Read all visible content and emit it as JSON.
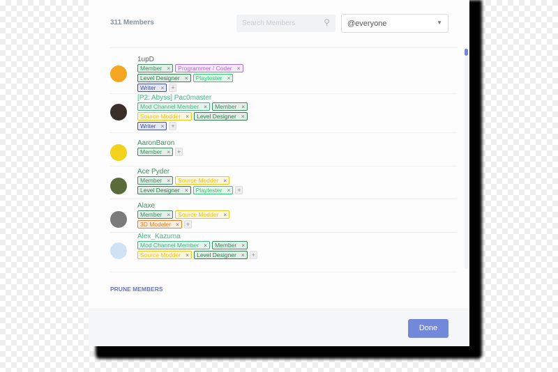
{
  "header": {
    "member_count": "311 Members",
    "search_placeholder": "Search Members",
    "role_filter": "@everyone"
  },
  "role_colors": {
    "Member": "#3d8c5e",
    "Mod Channel Member": "#43b581",
    "Level Designer": "#2f7d4c",
    "Playtester": "#2ecc71",
    "Programmer / Coder": "#b36ad8",
    "Source Modder": "#f1c40f",
    "Writer": "#3f4f99",
    "3D Modeler": "#e67e22"
  },
  "members": [
    {
      "name": "1upD",
      "name_color": "#5a6a5e",
      "avatar": "discord-logo",
      "avatar_color": "#f5a623",
      "roles": [
        "Member",
        "Programmer / Coder",
        "Level Designer",
        "Playtester",
        "Writer"
      ]
    },
    {
      "name": "[P2: Abyss] Pac0master",
      "name_color": "#43b581",
      "avatar": "user-photo",
      "avatar_color": "#3a2e28",
      "roles": [
        "Mod Channel Member",
        "Member",
        "Source Modder",
        "Level Designer",
        "Writer"
      ]
    },
    {
      "name": "AaronBaron",
      "name_color": "#3d8c5e",
      "avatar": "cartoon-face",
      "avatar_color": "#f2d21b",
      "roles": [
        "Member"
      ]
    },
    {
      "name": "Ace Pyder",
      "name_color": "#3d8c5e",
      "avatar": "user-photo",
      "avatar_color": "#5b6b3a",
      "roles": [
        "Member",
        "Source Modder",
        "Level Designer",
        "Playtester"
      ]
    },
    {
      "name": "Alaxe",
      "name_color": "#3d8c5e",
      "avatar": "default",
      "avatar_color": "#7a7a7a",
      "roles": [
        "Member",
        "Source Modder",
        "3D Modeler"
      ]
    },
    {
      "name": "Alex_Kazuma",
      "name_color": "#43b581",
      "avatar": "anime-character",
      "avatar_color": "#cfe3f5",
      "roles": [
        "Mod Channel Member",
        "Member",
        "Source Modder",
        "Level Designer"
      ]
    }
  ],
  "add_role_label": "+",
  "remove_role_label": "×",
  "prune_label": "PRUNE MEMBERS",
  "done_label": "Done",
  "accent": "#7289da"
}
